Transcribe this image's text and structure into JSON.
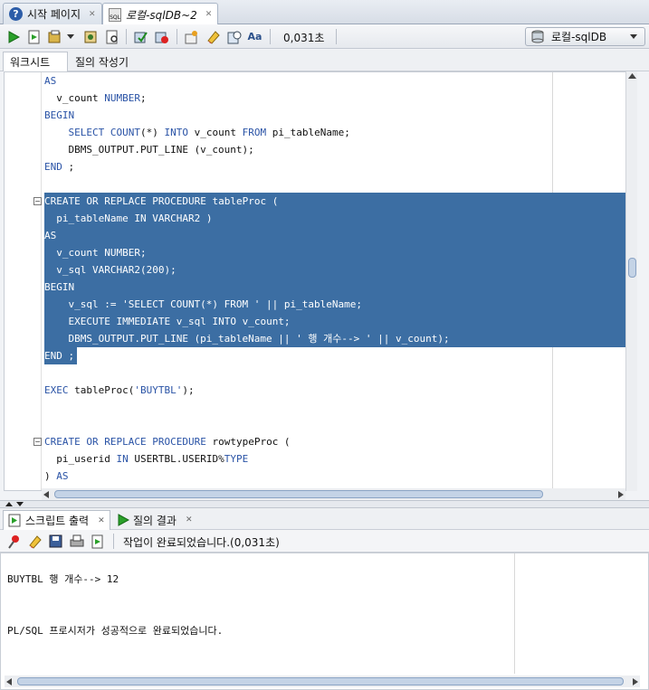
{
  "doc_tabs": [
    {
      "label": "시작 페이지",
      "icon": "help-icon"
    },
    {
      "label": "로컬-sqlDB~2",
      "icon": "sql-worksheet-icon"
    }
  ],
  "toolbar": {
    "timing": "0,031초",
    "connection": "로컬-sqlDB",
    "icons": [
      "run-statement-icon",
      "run-script-icon",
      "commit-icon",
      "autotrace-icon",
      "explain-plan-icon",
      "rollback-icon",
      "cancel-icon",
      "sql-tuning-icon",
      "clear-icon",
      "history-icon",
      "uppercase-icon"
    ]
  },
  "sub_tabs": {
    "worksheet": "워크시트",
    "query_builder": "질의 작성기"
  },
  "editor": {
    "lines": [
      {
        "t": "AS"
      },
      {
        "t": "  v_count NUMBER;"
      },
      {
        "t": "BEGIN"
      },
      {
        "t": "    SELECT COUNT(*) INTO v_count FROM pi_tableName;"
      },
      {
        "t": "    DBMS_OUTPUT.PUT_LINE (v_count);"
      },
      {
        "t": "END ;"
      },
      {
        "t": ""
      },
      {
        "t": "CREATE OR REPLACE PROCEDURE tableProc ("
      },
      {
        "t": "  pi_tableName IN VARCHAR2 )"
      },
      {
        "t": "AS"
      },
      {
        "t": "  v_count NUMBER;"
      },
      {
        "t": "  v_sql VARCHAR2(200);"
      },
      {
        "t": "BEGIN"
      },
      {
        "t": "    v_sql := 'SELECT COUNT(*) FROM ' || pi_tableName;"
      },
      {
        "t": "    EXECUTE IMMEDIATE v_sql INTO v_count;"
      },
      {
        "t": "    DBMS_OUTPUT.PUT_LINE (pi_tableName || ' 행 개수--> ' || v_count);"
      },
      {
        "t": "END ;"
      },
      {
        "t": ""
      },
      {
        "t": "EXEC tableProc('BUYTBL');"
      },
      {
        "t": ""
      },
      {
        "t": ""
      },
      {
        "t": "CREATE OR REPLACE PROCEDURE rowtypeProc ("
      },
      {
        "t": "  pi_userid IN USERTBL.USERID%TYPE"
      },
      {
        "t": ") AS"
      }
    ]
  },
  "output_tabs": [
    {
      "label": "스크립트 출력",
      "icon": "script-output-icon"
    },
    {
      "label": "질의 결과",
      "icon": "query-result-icon"
    }
  ],
  "output_toolbar": {
    "status": "작업이 완료되었습니다.(0,031초)",
    "icons": [
      "pin-icon",
      "eraser-icon",
      "save-icon",
      "print-icon",
      "open-file-icon"
    ]
  },
  "output": {
    "lines": [
      "BUYTBL 행 개수--> 12",
      "PL/SQL 프로시저가 성공적으로 완료되었습니다."
    ]
  },
  "colors": {
    "selection": "#3c6ea3",
    "keyword": "#2a53a6"
  }
}
